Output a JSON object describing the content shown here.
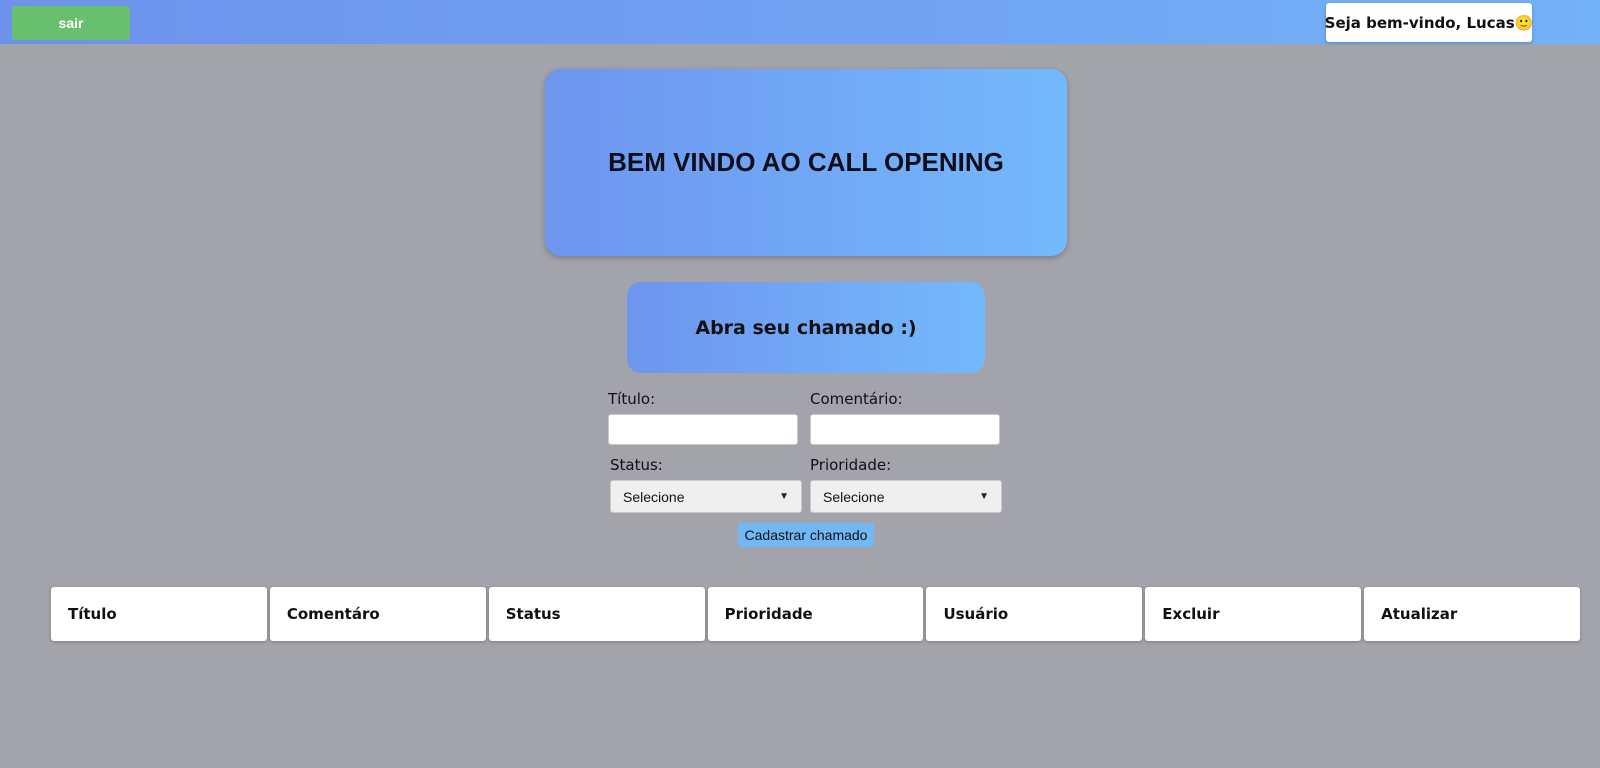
{
  "header": {
    "logout_label": "sair",
    "welcome_text": "Seja bem-vindo, Lucas🙂"
  },
  "hero": {
    "title": "BEM VINDO AO CALL OPENING"
  },
  "form_section": {
    "heading": "Abra seu chamado :)",
    "titulo_label": "Título:",
    "titulo_value": "",
    "comentario_label": "Comentário:",
    "comentario_value": "",
    "status_label": "Status:",
    "status_selected": "Selecione",
    "prioridade_label": "Prioridade:",
    "prioridade_selected": "Selecione",
    "submit_label": "Cadastrar chamado"
  },
  "table": {
    "headers": [
      "Título",
      "Comentáro",
      "Status",
      "Prioridade",
      "Usuário",
      "Excluir",
      "Atualizar"
    ]
  },
  "colors": {
    "gradient_start": "#6d92ec",
    "gradient_end": "#74b9fc",
    "logout_green": "#68bf6d",
    "submit_blue": "#72b8f5",
    "page_background": "#a3a3ab"
  },
  "icons": {
    "dropdown": "chevron-down-icon"
  }
}
